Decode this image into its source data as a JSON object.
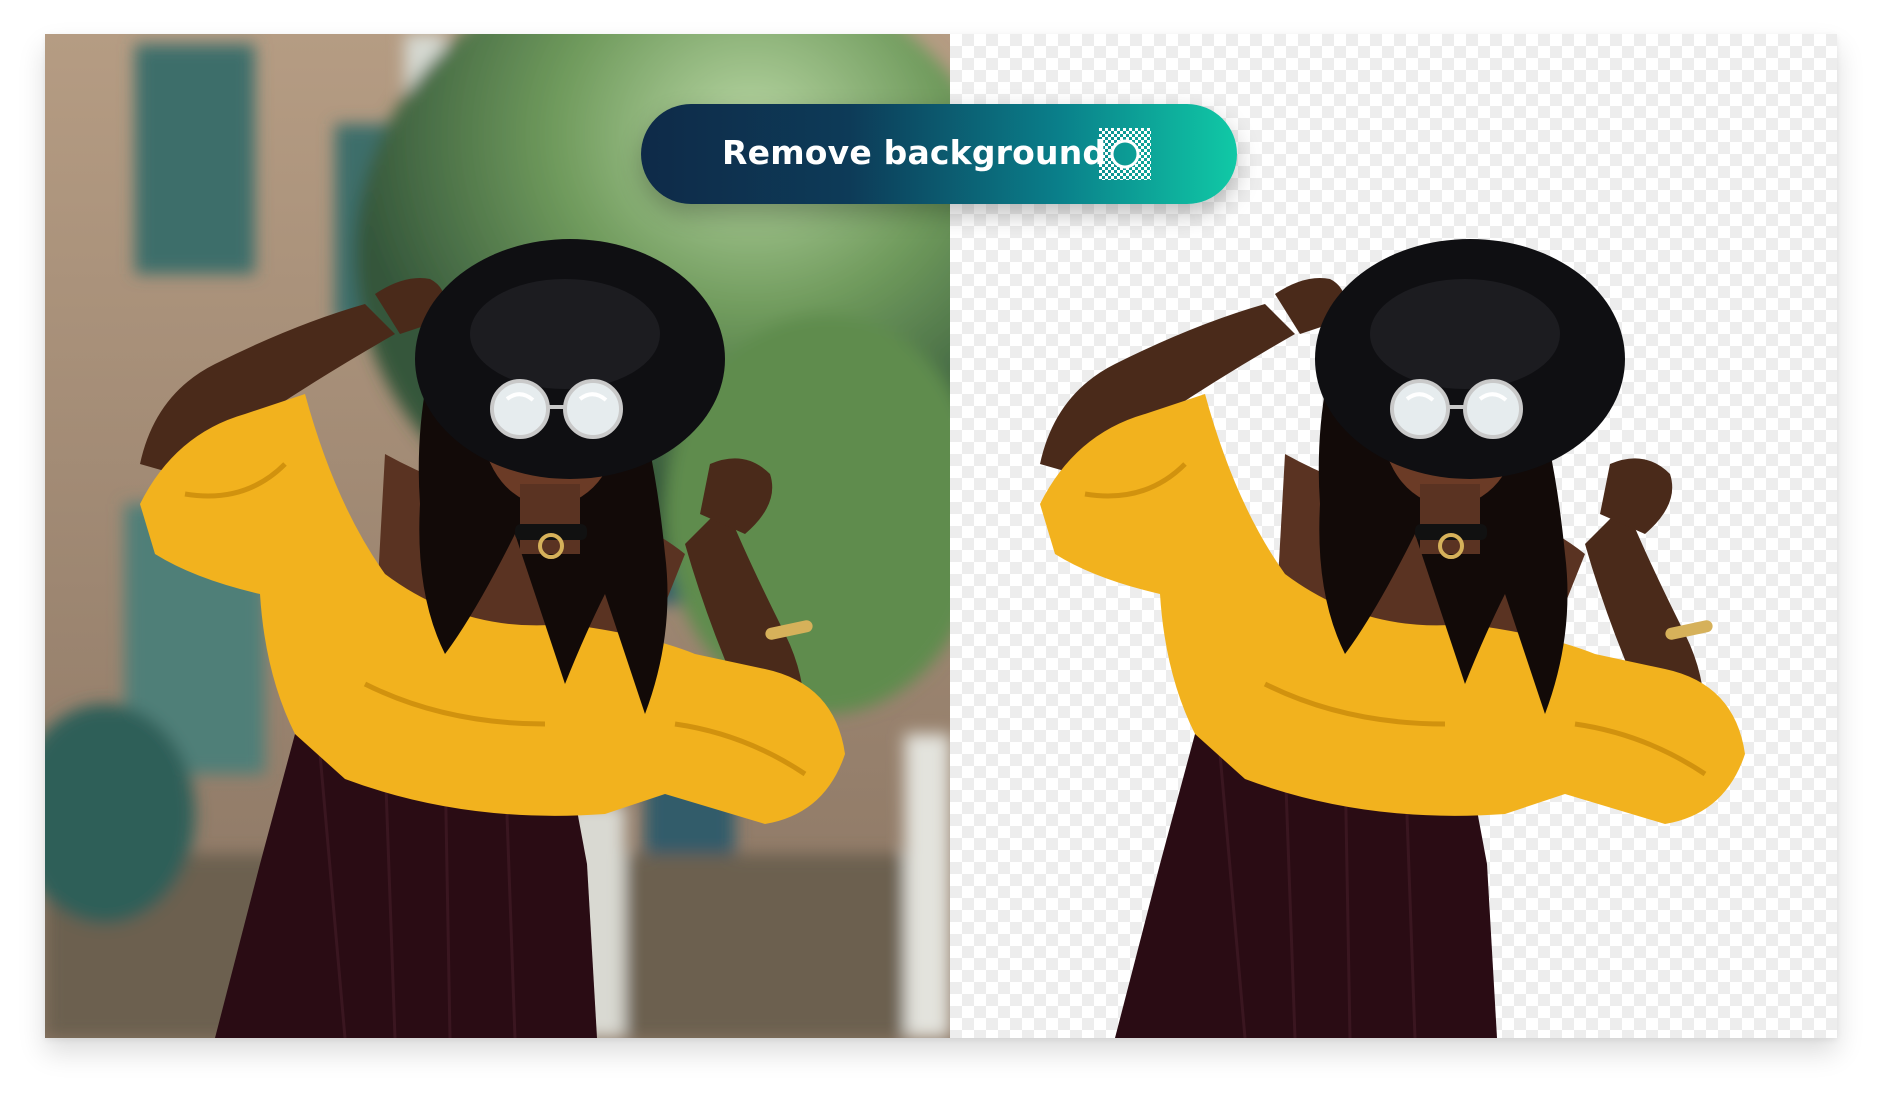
{
  "action_button": {
    "label": "Remove background",
    "icon": "transparency-icon"
  },
  "panels": {
    "original": "woman-yellow-top-with-background",
    "result": "woman-yellow-top-transparent-background"
  },
  "colors": {
    "button_gradient_start": "#0e2a48",
    "button_gradient_end": "#10c9a6",
    "shirt_yellow": "#f2b21e",
    "checker_light": "#ededed"
  }
}
